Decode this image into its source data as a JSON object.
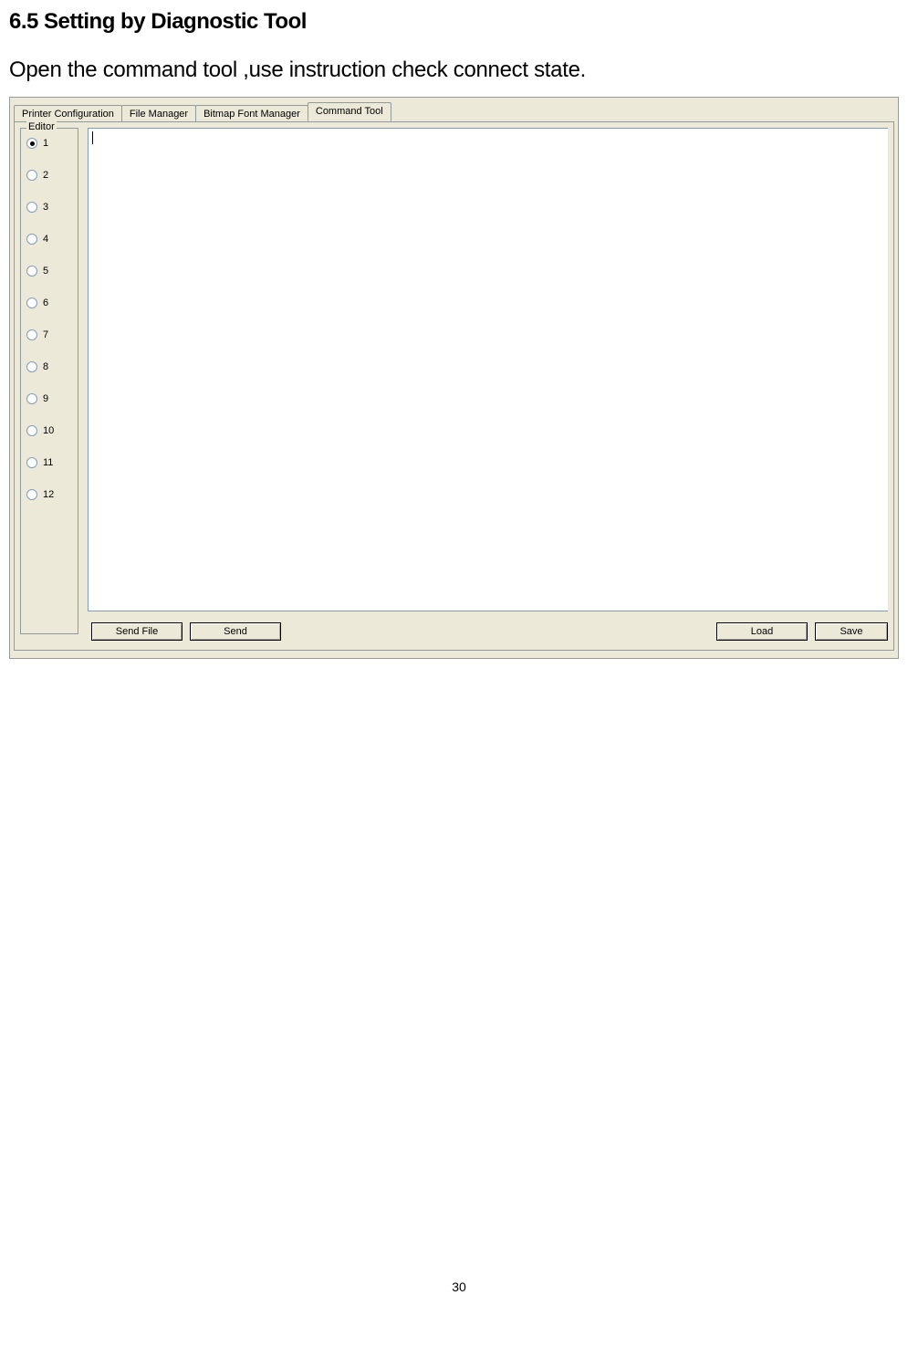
{
  "heading": "6.5 Setting by Diagnostic Tool",
  "body_text": "Open the command tool ,use instruction check connect state.",
  "tabs": [
    {
      "label": "Printer Configuration",
      "active": false
    },
    {
      "label": "File Manager",
      "active": false
    },
    {
      "label": "Bitmap Font Manager",
      "active": false
    },
    {
      "label": "Command Tool",
      "active": true
    }
  ],
  "editor": {
    "legend": "Editor",
    "options": [
      "1",
      "2",
      "3",
      "4",
      "5",
      "6",
      "7",
      "8",
      "9",
      "10",
      "11",
      "12"
    ],
    "selected": "1"
  },
  "buttons": {
    "send_file": "Send File",
    "send": "Send",
    "load": "Load",
    "save": "Save"
  },
  "page_number": "30"
}
